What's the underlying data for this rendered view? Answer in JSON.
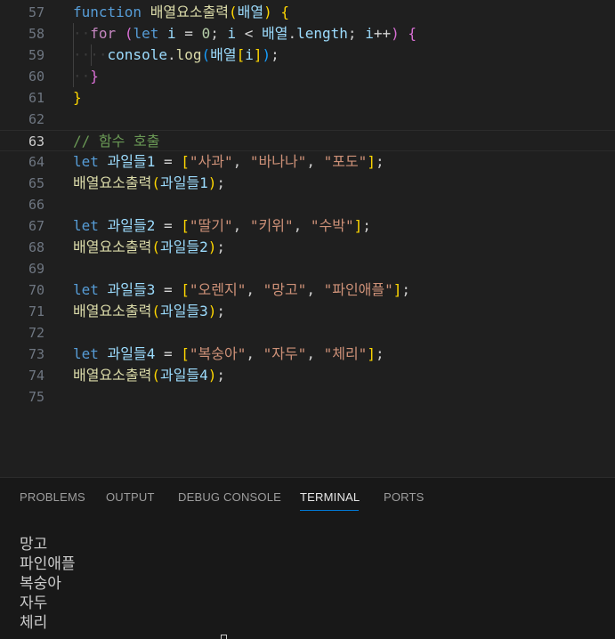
{
  "editor": {
    "lines": [
      {
        "n": "57"
      },
      {
        "n": "58"
      },
      {
        "n": "59"
      },
      {
        "n": "60"
      },
      {
        "n": "61"
      },
      {
        "n": "62"
      },
      {
        "n": "63"
      },
      {
        "n": "64"
      },
      {
        "n": "65"
      },
      {
        "n": "66"
      },
      {
        "n": "67"
      },
      {
        "n": "68"
      },
      {
        "n": "69"
      },
      {
        "n": "70"
      },
      {
        "n": "71"
      },
      {
        "n": "72"
      },
      {
        "n": "73"
      },
      {
        "n": "74"
      },
      {
        "n": "75"
      }
    ],
    "active_line": "63",
    "tokens": {
      "kw_function": "function",
      "fn_name": "배열요소출력",
      "param": "배열",
      "kw_for": "for",
      "kw_let": "let",
      "var_i": "i",
      "zero": "0",
      "length": "length",
      "console": "console",
      "log": "log",
      "comment": "// 함수 호출",
      "fruits1": "과일들1",
      "fruits2": "과일들2",
      "fruits3": "과일들3",
      "fruits4": "과일들4",
      "s_apple": "\"사과\"",
      "s_banana": "\"바나나\"",
      "s_grape": "\"포도\"",
      "s_strawberry": "\"딸기\"",
      "s_kiwi": "\"키위\"",
      "s_watermelon": "\"수박\"",
      "s_orange": "\"오렌지\"",
      "s_mango": "\"망고\"",
      "s_pineapple": "\"파인애플\"",
      "s_peach": "\"복숭아\"",
      "s_plum": "\"자두\"",
      "s_cherry": "\"체리\""
    }
  },
  "panel": {
    "tabs": [
      {
        "label": "PROBLEMS"
      },
      {
        "label": "OUTPUT"
      },
      {
        "label": "DEBUG CONSOLE"
      },
      {
        "label": "TERMINAL"
      },
      {
        "label": "PORTS"
      }
    ],
    "active_tab": "TERMINAL",
    "terminal_output": [
      "망고",
      "파인애플",
      "복숭아",
      "자두",
      "체리"
    ]
  },
  "colors": {
    "editor_bg": "#1f1f1f",
    "panel_bg": "#181818",
    "keyword": "#569cd6",
    "control_keyword": "#c586c0",
    "function": "#dcdcaa",
    "variable": "#9cdcfe",
    "string": "#ce9178",
    "number": "#b5cea8",
    "comment": "#6a9955",
    "accent": "#0078d4"
  }
}
